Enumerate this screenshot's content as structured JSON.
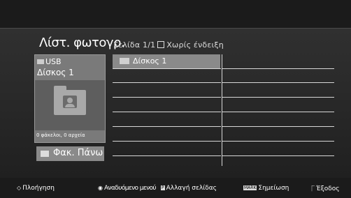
{
  "header": {
    "title": "Λίστ. φωτογρ.",
    "page_info": "Σελίδα 1/1",
    "no_display": "Χωρίς ένδειξη"
  },
  "device_panel": {
    "usb_label": "USB",
    "disk_label": "Δίσκος 1",
    "count_text": "0 φάκελοι, 0 αρχεία"
  },
  "folder_up_label": "Φακ. Πάνω",
  "file_list": {
    "items": [
      "Δίσκος 1"
    ]
  },
  "footer": {
    "navigation": "Πλοήγηση",
    "popup_menu": "Αναδυόμενο μενού",
    "page_change_key": "P",
    "page_change": "Αλλαγή σελίδας",
    "mark_key": "MARK",
    "mark": "Σημείωση",
    "exit": "Έξοδος"
  }
}
